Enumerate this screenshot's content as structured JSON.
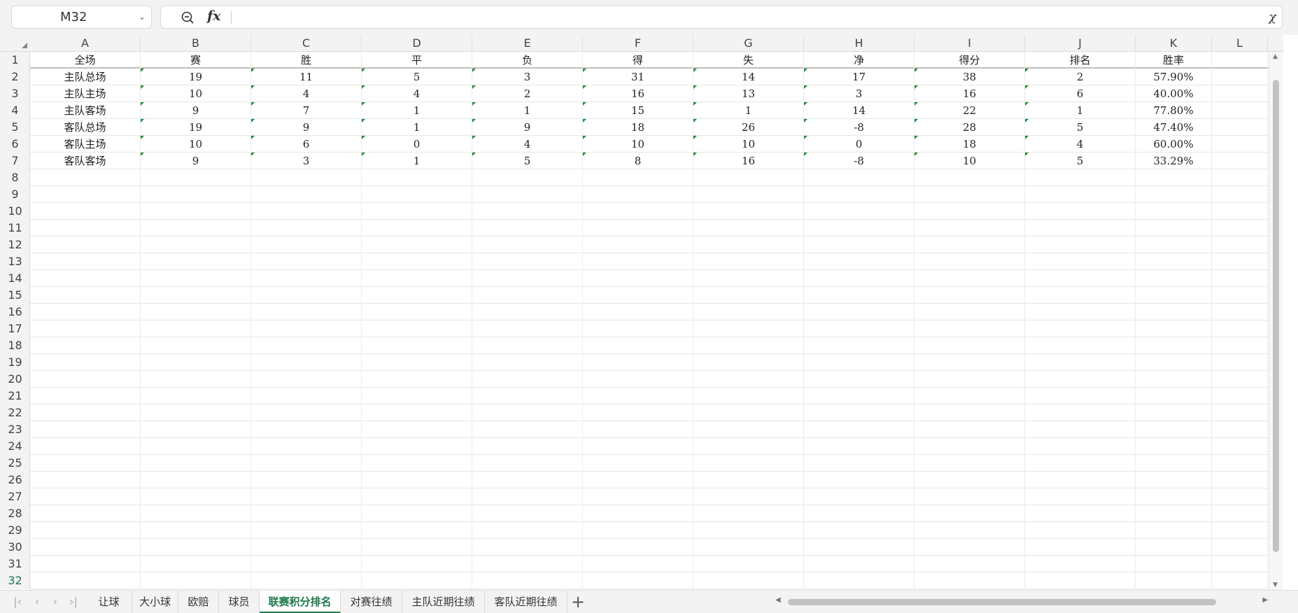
{
  "formula_bar": {
    "cell_ref": "M32",
    "fx_label": "fx",
    "formula_value": ""
  },
  "columns": [
    "A",
    "B",
    "C",
    "D",
    "E",
    "F",
    "G",
    "H",
    "I",
    "J",
    "K",
    "L"
  ],
  "rows": [
    "1",
    "2",
    "3",
    "4",
    "5",
    "6",
    "7",
    "8",
    "9",
    "10",
    "11",
    "12",
    "13",
    "14",
    "15",
    "16",
    "17",
    "18",
    "19",
    "20",
    "21",
    "22",
    "23",
    "24",
    "25",
    "26",
    "27",
    "28",
    "29",
    "30",
    "31",
    "32"
  ],
  "active_row": "32",
  "table": {
    "header": [
      "全场",
      "赛",
      "胜",
      "平",
      "负",
      "得",
      "失",
      "净",
      "得分",
      "排名",
      "胜率"
    ],
    "body": [
      [
        "主队总场",
        "19",
        "11",
        "5",
        "3",
        "31",
        "14",
        "17",
        "38",
        "2",
        "57.90%"
      ],
      [
        "主队主场",
        "10",
        "4",
        "4",
        "2",
        "16",
        "13",
        "3",
        "16",
        "6",
        "40.00%"
      ],
      [
        "主队客场",
        "9",
        "7",
        "1",
        "1",
        "15",
        "1",
        "14",
        "22",
        "1",
        "77.80%"
      ],
      [
        "客队总场",
        "19",
        "9",
        "1",
        "9",
        "18",
        "26",
        "-8",
        "28",
        "5",
        "47.40%"
      ],
      [
        "客队主场",
        "10",
        "6",
        "0",
        "4",
        "10",
        "10",
        "0",
        "18",
        "4",
        "60.00%"
      ],
      [
        "客队客场",
        "9",
        "3",
        "1",
        "5",
        "8",
        "16",
        "-8",
        "10",
        "5",
        "33.29%"
      ]
    ]
  },
  "sheet_tabs": [
    {
      "label": "让球",
      "active": false
    },
    {
      "label": "大小球",
      "active": false
    },
    {
      "label": "欧赔",
      "active": false
    },
    {
      "label": "球员",
      "active": false
    },
    {
      "label": "联赛积分排名",
      "active": true
    },
    {
      "label": "对赛往绩",
      "active": false
    },
    {
      "label": "主队近期往绩",
      "active": false
    },
    {
      "label": "客队近期往绩",
      "active": false
    }
  ],
  "colors": {
    "accent": "#1f7a4d",
    "flag": "#1e8c3a"
  },
  "icons": {
    "zoom": "zoom-out-icon",
    "cancel": "cancel-formula-icon",
    "add": "plus-icon"
  }
}
